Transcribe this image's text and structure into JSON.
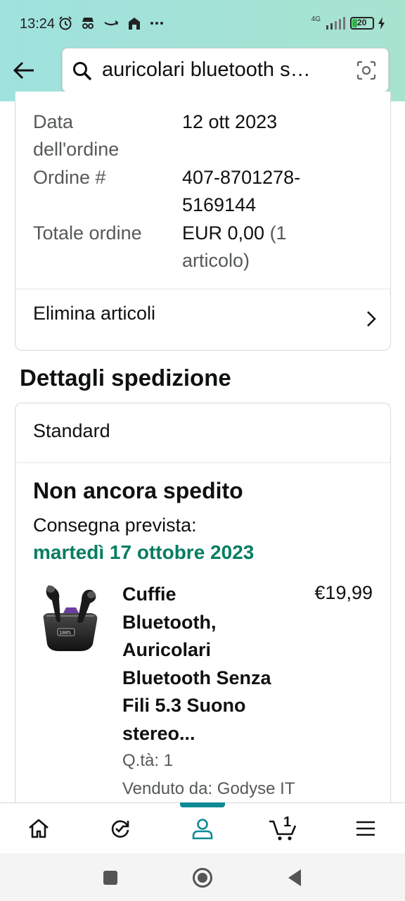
{
  "status_bar": {
    "time": "13:24",
    "network": "4G",
    "battery": "20"
  },
  "search": {
    "query": "auricolari bluetooth s…"
  },
  "order_summary": {
    "rows": [
      {
        "label_line1": "Data",
        "label_line2": "dell'ordine",
        "value_line1": "12 ott 2023",
        "value_line2": ""
      },
      {
        "label_line1": "Ordine #",
        "label_line2": "",
        "value_line1": "407-8701278-",
        "value_line2": "5169144"
      },
      {
        "label_line1": "Totale ordine",
        "label_line2": "",
        "value_line1": "EUR 0,00",
        "value_extra": " (1",
        "value_line2": "articolo)"
      }
    ],
    "delete_items_label": "Elimina articoli"
  },
  "shipping": {
    "section_title": "Dettagli spedizione",
    "method": "Standard",
    "status": "Non ancora spedito",
    "delivery_label": "Consegna prevista:",
    "delivery_date": "martedì 17 ottobre 2023",
    "item": {
      "title_lines": [
        "Cuffie",
        "Bluetooth,",
        "Auricolari",
        "Bluetooth Senza",
        "Fili 5.3 Suono",
        "stereo..."
      ],
      "price": "€19,99",
      "quantity": "Q.tà: 1",
      "seller": "Venduto da: Godyse IT"
    }
  },
  "bottom_nav": {
    "cart_count": "1",
    "active_tab": "account"
  },
  "colors": {
    "header_bg": "#a3e2d6",
    "delivery_green": "#067d62",
    "active_tab": "#0e8a96",
    "muted_text": "#565959"
  }
}
